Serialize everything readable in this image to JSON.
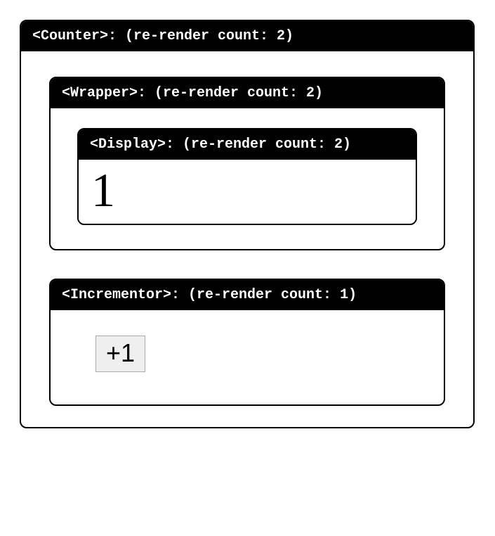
{
  "counter": {
    "header": "<Counter>: (re-render count: 2)"
  },
  "wrapper": {
    "header": "<Wrapper>: (re-render count: 2)"
  },
  "display": {
    "header": "<Display>: (re-render count: 2)",
    "value": "1"
  },
  "incrementor": {
    "header": "<Incrementor>: (re-render count: 1)",
    "button_label": "+1"
  }
}
